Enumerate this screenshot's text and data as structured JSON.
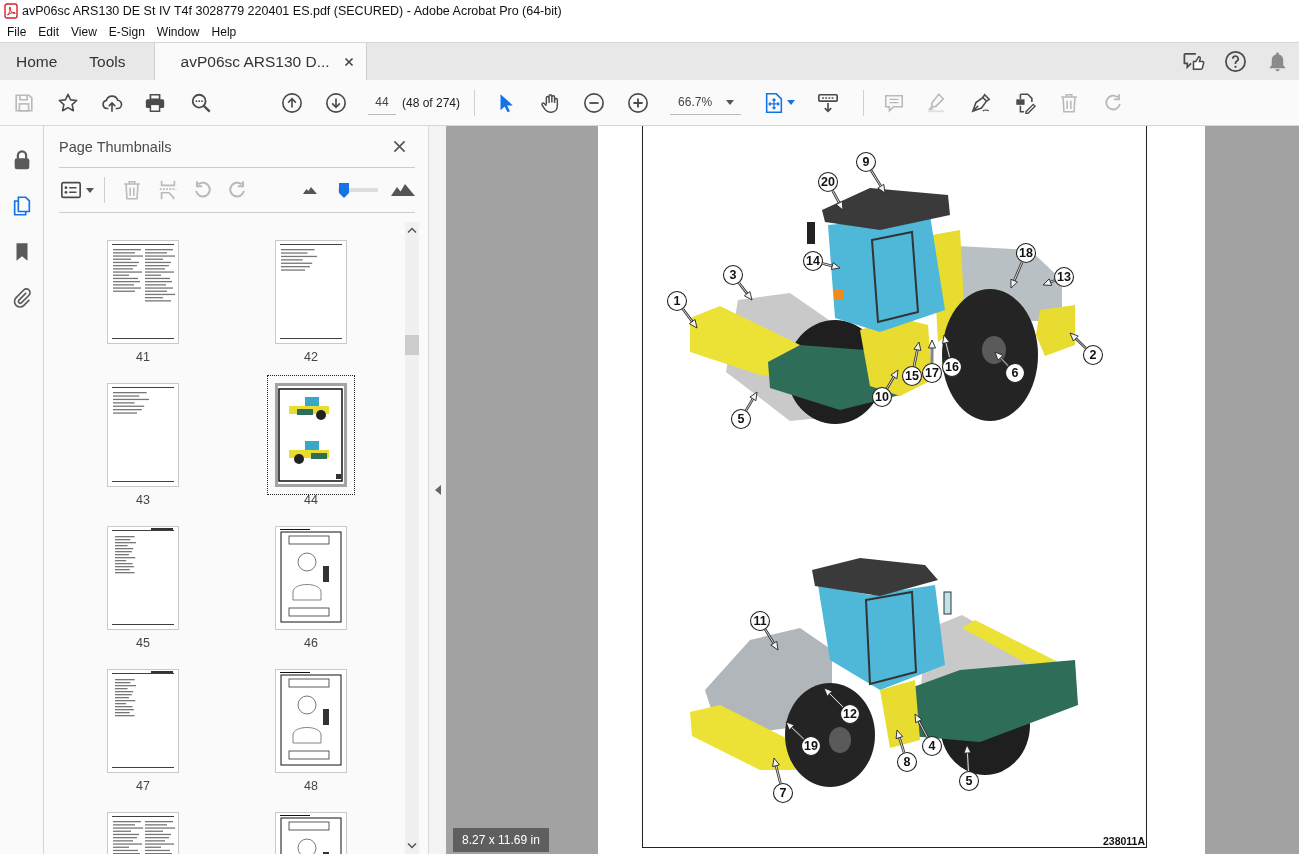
{
  "window": {
    "title": "avP06sc ARS130 DE St IV T4f 3028779 220401 ES.pdf (SECURED) - Adobe Acrobat Pro (64-bit)"
  },
  "menu": [
    "File",
    "Edit",
    "View",
    "E-Sign",
    "Window",
    "Help"
  ],
  "tabs": [
    {
      "label": "Home",
      "selected": false,
      "closable": false
    },
    {
      "label": "Tools",
      "selected": false,
      "closable": false
    },
    {
      "label": "avP06sc ARS130 D...",
      "selected": true,
      "closable": true
    }
  ],
  "toolbar": {
    "save": {
      "disabled": true
    },
    "bookmark": {
      "disabled": false
    },
    "share": {
      "disabled": false
    },
    "print": {
      "disabled": false
    },
    "find": {
      "disabled": false
    },
    "previous_page": {
      "disabled": false
    },
    "next_page": {
      "disabled": false
    },
    "page_number": {
      "value": "44"
    },
    "page_count": "(48 of 274)",
    "select_tool": {
      "selected": true
    },
    "hand_tool": {
      "selected": false
    },
    "zoom_out": {
      "disabled": false
    },
    "zoom_in": {
      "disabled": false
    },
    "zoom": {
      "value": "66.7%"
    },
    "comment": {
      "disabled": true
    },
    "highlight": {
      "disabled": true
    },
    "sign": {
      "disabled": false
    },
    "edit": {
      "disabled": false
    },
    "delete": {
      "disabled": true
    },
    "redo": {
      "disabled": true
    }
  },
  "side_rail": [
    {
      "selected": false
    },
    {
      "selected": true
    },
    {
      "selected": false
    },
    {
      "selected": false
    }
  ],
  "thumbnails_panel": {
    "title": "Page Thumbnails",
    "tools": {
      "options": {
        "disabled": false
      },
      "delete": {
        "disabled": true
      },
      "extract": {
        "disabled": true
      },
      "rotate_left": {
        "disabled": true
      },
      "rotate_right": {
        "disabled": true
      }
    },
    "size_slider": {
      "level": 0.15
    },
    "pages": [
      {
        "label": "41",
        "kind": "columns",
        "selected": false
      },
      {
        "label": "42",
        "kind": "text",
        "selected": false
      },
      {
        "label": "43",
        "kind": "text",
        "selected": false
      },
      {
        "label": "44",
        "kind": "figure",
        "selected": true
      },
      {
        "label": "45",
        "kind": "list",
        "selected": false
      },
      {
        "label": "46",
        "kind": "diagram",
        "selected": false
      },
      {
        "label": "47",
        "kind": "list",
        "selected": false
      },
      {
        "label": "48",
        "kind": "diagram",
        "selected": false
      },
      {
        "kind": "columns",
        "selected": false
      },
      {
        "kind": "diagram",
        "selected": false
      }
    ]
  },
  "document": {
    "figures": [
      {
        "callouts": [
          "9",
          "20",
          "3",
          "14",
          "18",
          "13",
          "1",
          "15",
          "17",
          "16",
          "6",
          "2",
          "10",
          "5"
        ]
      },
      {
        "callouts": [
          "11",
          "12",
          "19",
          "8",
          "4",
          "7",
          "5"
        ]
      }
    ],
    "figure_code": "238011A",
    "page_size": "8.27 x 11.69 in"
  }
}
